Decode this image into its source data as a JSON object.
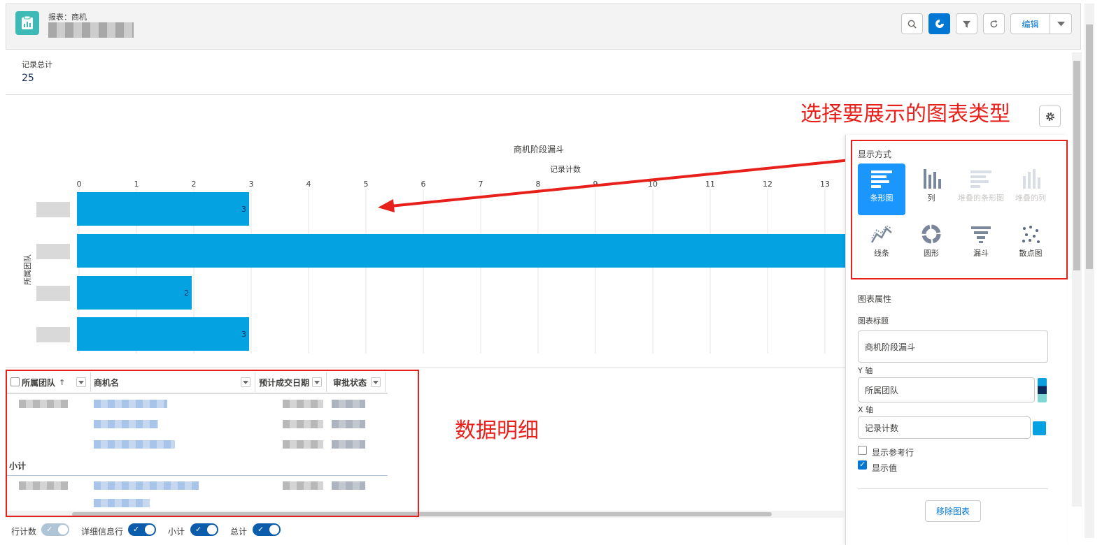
{
  "header": {
    "kicker": "报表：商机",
    "buttons": {
      "edit": "编辑"
    }
  },
  "summary": {
    "label": "记录总计",
    "value": "25"
  },
  "annotations": {
    "chart_type": "选择要展示的图表类型",
    "data_detail": "数据明细"
  },
  "chart_data": {
    "type": "bar",
    "orientation": "horizontal",
    "title": "商机阶段漏斗",
    "xlabel": "记录计数",
    "ylabel": "所属团队",
    "xlim": [
      0,
      13
    ],
    "xticks": [
      "0",
      "1",
      "2",
      "3",
      "4",
      "5",
      "6",
      "7",
      "8",
      "9",
      "10",
      "11",
      "12",
      "13"
    ],
    "values": [
      3,
      13,
      2,
      3
    ],
    "value_labels": [
      "3",
      "",
      "2",
      "3"
    ],
    "color": "#05a2e2"
  },
  "panel": {
    "display_label": "显示方式",
    "types": [
      {
        "label": "条形图",
        "icon": "bar-chart-icon",
        "state": "selected"
      },
      {
        "label": "列",
        "icon": "column-chart-icon",
        "state": "normal"
      },
      {
        "label": "堆叠的条形图",
        "icon": "stacked-bar-icon",
        "state": "disabled"
      },
      {
        "label": "堆叠的列",
        "icon": "stacked-column-icon",
        "state": "disabled"
      },
      {
        "label": "线条",
        "icon": "line-chart-icon",
        "state": "normal"
      },
      {
        "label": "圆形",
        "icon": "donut-chart-icon",
        "state": "normal"
      },
      {
        "label": "漏斗",
        "icon": "funnel-chart-icon",
        "state": "normal"
      },
      {
        "label": "散点图",
        "icon": "scatter-chart-icon",
        "state": "normal"
      }
    ],
    "props_label": "图表属性",
    "title_label": "图表标题",
    "title_value": "商机阶段漏斗",
    "y_label": "Y 轴",
    "y_value": "所属团队",
    "x_label": "X 轴",
    "x_value": "记录计数",
    "show_ref": "显示参考行",
    "show_values": "显示值",
    "remove": "移除图表",
    "accent": "#1b96ff"
  },
  "table": {
    "headers": [
      "所属团队",
      "商机名",
      "预计成交日期",
      "审批状态"
    ],
    "sort_arrow": "↑",
    "subtotal": "小计"
  },
  "footer": {
    "row_count": "行计数",
    "detail_rows": "详细信息行",
    "subtotals": "小计",
    "grand_total": "总计"
  }
}
